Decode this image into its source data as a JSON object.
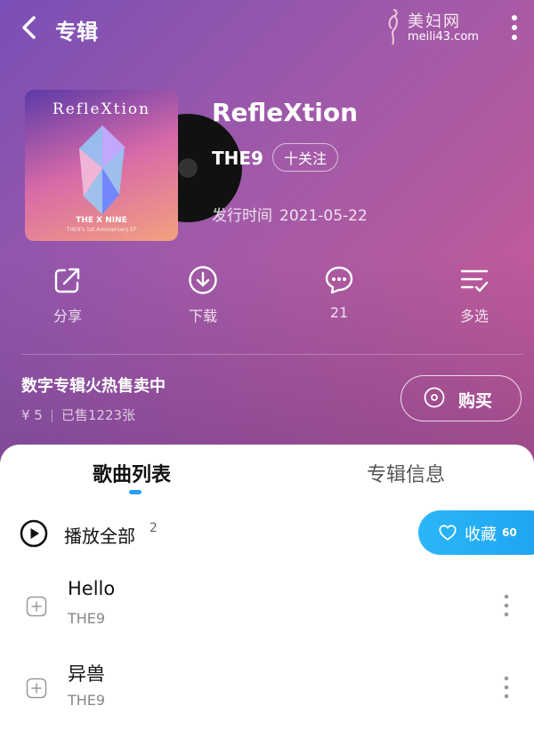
{
  "header": {
    "title": "专辑"
  },
  "watermark": {
    "cn": "美妇网",
    "url": "meili43.com"
  },
  "album": {
    "cover_title": "RefleXtion",
    "cover_logo": "THE X NINE",
    "cover_subtitle": "THE9's 1st Anniversary EP",
    "name": "RefleXtion",
    "artist": "THE9",
    "follow_label": "十关注",
    "release_label": "发行时间",
    "release_date": "2021-05-22"
  },
  "actions": [
    {
      "label": "分享",
      "icon": "share-icon"
    },
    {
      "label": "下载",
      "icon": "download-icon"
    },
    {
      "label": "21",
      "icon": "comment-icon"
    },
    {
      "label": "多选",
      "icon": "multiselect-icon"
    }
  ],
  "sale": {
    "title": "数字专辑火热售卖中",
    "price": "¥ 5",
    "sold": "已售1223张",
    "buy_label": "购买"
  },
  "tabs": [
    {
      "label": "歌曲列表",
      "active": true
    },
    {
      "label": "专辑信息",
      "active": false
    }
  ],
  "playlist": {
    "play_all_label": "播放全部",
    "count": "2",
    "fav_label": "收藏",
    "fav_count": "60"
  },
  "songs": [
    {
      "name": "Hello",
      "artist": "THE9"
    },
    {
      "name": "异兽",
      "artist": "THE9"
    }
  ],
  "colors": {
    "accent": "#2a9df4",
    "hero_start": "#7a4fb6",
    "hero_end": "#cf5b94"
  }
}
